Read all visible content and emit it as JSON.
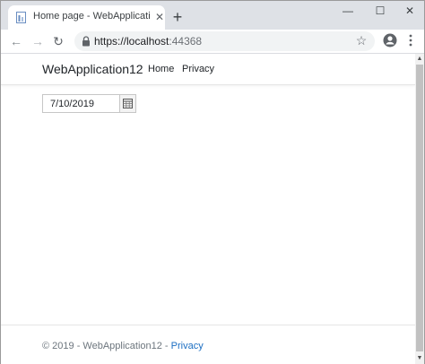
{
  "browser": {
    "tab_title": "Home page - WebApplication12...",
    "tab_favicon_icon": "document-icon",
    "new_tab_label": "+",
    "url_host": "https://localhost",
    "url_port": ":44368"
  },
  "site": {
    "brand": "WebApplication12",
    "nav_links": [
      "Home",
      "Privacy"
    ],
    "date_value": "7/10/2019",
    "footer_text": "© 2019 - WebApplication12 - ",
    "footer_link": "Privacy"
  },
  "colors": {
    "tab_strip": "#dee1e6",
    "omnibox": "#f1f3f4",
    "link": "#1b6ec2",
    "footer_text": "#6c757d"
  }
}
